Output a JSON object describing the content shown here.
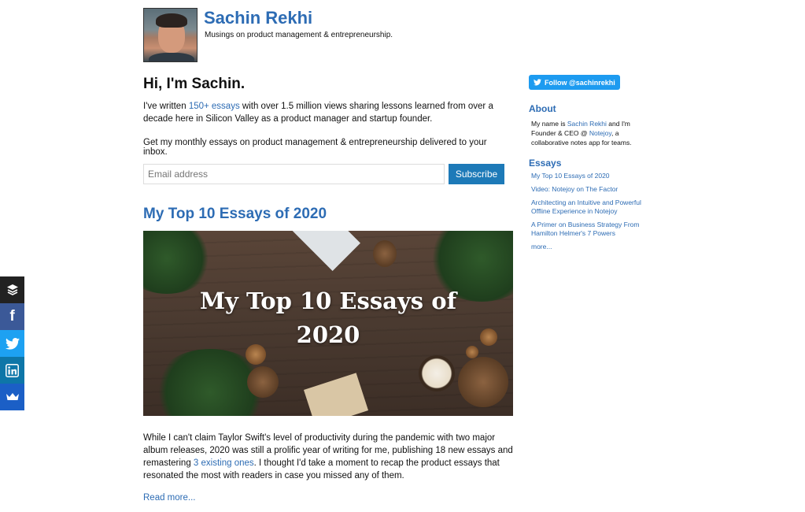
{
  "header": {
    "title": "Sachin Rekhi",
    "tagline": "Musings on product management & entrepreneurship."
  },
  "intro": {
    "heading": "Hi, I'm Sachin.",
    "text_before": "I've written ",
    "essays_link": "150+ essays",
    "text_after": " with over 1.5 million views sharing lessons learned from over a decade here in Silicon Valley as a product manager and startup founder.",
    "subscribe_text": "Get my monthly essays on product management & entrepreneurship delivered to your inbox.",
    "email_placeholder": "Email address",
    "subscribe_label": "Subscribe"
  },
  "post": {
    "title": "My Top 10 Essays of 2020",
    "image_text_line1": "My Top 10 Essays of",
    "image_text_line2": "2020",
    "body_before": "While I can't claim Taylor Swift's level of productivity during the pandemic with two major album releases, 2020 was still a prolific year of writing for me, publishing 18 new essays and remastering ",
    "body_link": "3 existing ones",
    "body_after": ". I thought I'd take a moment to recap the product essays that resonated the most with readers in case you missed any of them.",
    "read_more": "Read more..."
  },
  "sidebar": {
    "follow_label": "Follow @sachinrekhi",
    "about_heading": "About",
    "about_before": "My name is ",
    "about_name_link": "Sachin Rekhi",
    "about_middle": " and I'm Founder & CEO @ ",
    "about_company_link": "Notejoy",
    "about_after": ", a collaborative notes app for teams.",
    "essays_heading": "Essays",
    "essays": [
      "My Top 10 Essays of 2020",
      "Video: Notejoy on The Factor",
      "Architecting an Intuitive and Powerful Offline Experience in Notejoy",
      "A Primer on Business Strategy From Hamilton Helmer's 7 Powers"
    ],
    "more_label": "more..."
  },
  "share": {
    "icons": [
      "buffer-icon",
      "facebook-icon",
      "twitter-icon",
      "linkedin-icon",
      "sumo-crown-icon"
    ],
    "facebook_glyph": "f"
  },
  "colors": {
    "link": "#2d6cb4",
    "subscribe_button": "#1d7ab8",
    "twitter": "#1da1f2",
    "facebook": "#3b5998",
    "linkedin": "#0e76a8",
    "buffer": "#222222",
    "sumo": "#1b5fc6"
  }
}
